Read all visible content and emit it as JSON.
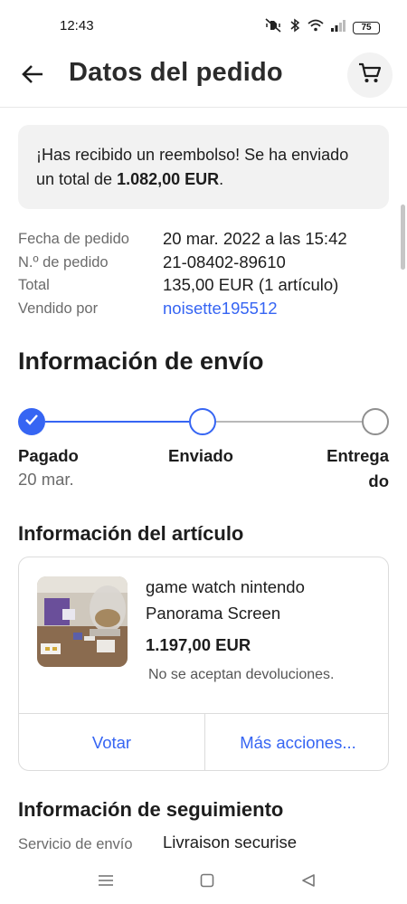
{
  "status_bar": {
    "time": "12:43",
    "battery": "75",
    "icons": [
      "mute-vibrate-icon",
      "bluetooth-icon",
      "wifi-icon",
      "signal-icon",
      "battery-icon"
    ]
  },
  "header": {
    "title": "Datos del pedido",
    "back_icon": "arrow-left-icon",
    "cart_icon": "shopping-cart-icon"
  },
  "refund": {
    "prefix": "¡Has recibido un reembolso! Se ha enviado un total de ",
    "amount": "1.082,00 EUR",
    "suffix": "."
  },
  "order": {
    "rows": [
      {
        "label": "Fecha de pedido",
        "value": "20 mar. 2022 a las 15:42"
      },
      {
        "label": "N.º de pedido",
        "value": "21-08402-89610"
      },
      {
        "label": "Total",
        "value": "135,00 EUR (1 artículo)"
      },
      {
        "label": "Vendido por",
        "value": "noisette195512"
      }
    ]
  },
  "shipping": {
    "title": "Información de envío",
    "steps": [
      {
        "label": "Pagado",
        "date": "20 mar.",
        "state": "done"
      },
      {
        "label": "Enviado",
        "state": "current"
      },
      {
        "label": "Entrega\ndo",
        "state": "pending"
      }
    ]
  },
  "item": {
    "section_title": "Información del artículo",
    "name": "game watch nintendo Panorama Screen",
    "price": "1.197,00 EUR",
    "returns": "No se aceptan devoluciones.",
    "actions": {
      "vote": "Votar",
      "more": "Más acciones..."
    }
  },
  "tracking": {
    "title": "Información de seguimiento",
    "label": "Servicio de envío",
    "value": "Livraison securise"
  },
  "colors": {
    "accent": "#3665f3",
    "text": "#1d1d1d",
    "muted": "#6b6b6b",
    "panel": "#f2f2f2"
  }
}
